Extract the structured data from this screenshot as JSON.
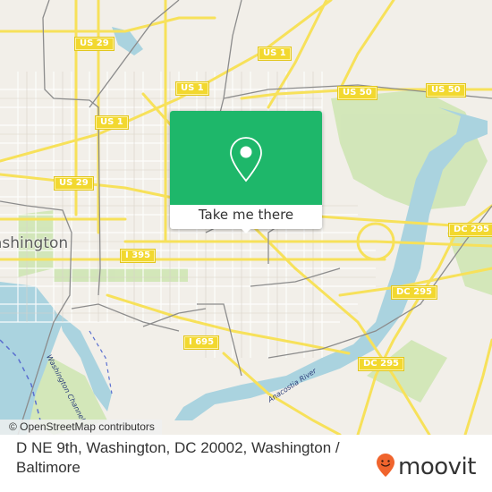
{
  "map": {
    "city_label": "ashington",
    "road_shields": [
      {
        "label": "US 29"
      },
      {
        "label": "US 1"
      },
      {
        "label": "US 1"
      },
      {
        "label": "US 1"
      },
      {
        "label": "US 50"
      },
      {
        "label": "US 50"
      },
      {
        "label": "US 29"
      },
      {
        "label": "I 395"
      },
      {
        "label": "DC 295"
      },
      {
        "label": "DC 295"
      },
      {
        "label": "I 695"
      },
      {
        "label": "DC 295"
      }
    ],
    "water_labels": {
      "channel": "Washington Channel",
      "river": "Anacostia River"
    },
    "attribution": "© OpenStreetMap contributors",
    "colors": {
      "land": "#f2efe9",
      "road": "#f7e15a",
      "water": "#aad3df",
      "park": "#cde6b0",
      "rail": "#8c8c8c"
    }
  },
  "popup": {
    "icon": "map-pin-icon",
    "button_label": "Take me there",
    "color": "#1eb76a"
  },
  "footer": {
    "address": "D NE 9th, Washington, DC 20002, Washington / Baltimore",
    "brand": "moovit",
    "brand_color": "#f0642d"
  }
}
